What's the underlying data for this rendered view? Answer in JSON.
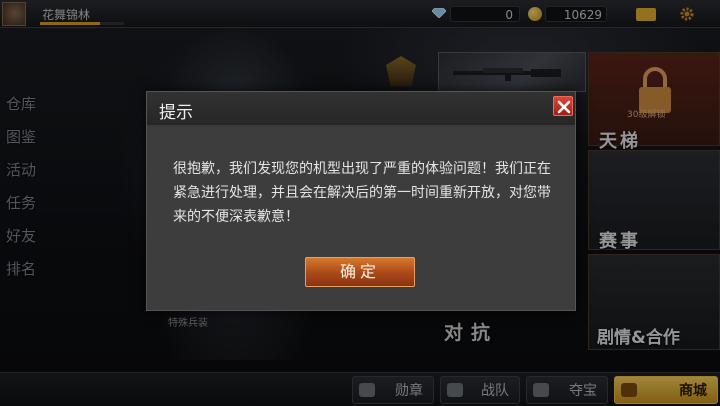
{
  "player": {
    "name": "花舞锦林",
    "xp_progress": 0.72
  },
  "currency": {
    "diamonds": "0",
    "gold": "10629",
    "diamond_icon": "diamond-icon",
    "gold_icon": "gold-coin-icon"
  },
  "left_menu": {
    "items": [
      {
        "label": "仓库"
      },
      {
        "label": "图鉴"
      },
      {
        "label": "活动"
      },
      {
        "label": "任务"
      },
      {
        "label": "好友"
      },
      {
        "label": "排名"
      }
    ]
  },
  "tiles": {
    "ladder_label": "天梯",
    "ladder_caption": "30级解锁",
    "match_label": "赛事",
    "story_label": "剧情&合作",
    "versus_label": "对抗"
  },
  "soldier_caption": "特殊兵装",
  "bottom": {
    "medal": "勋章",
    "team": "战队",
    "treasure": "夺宝",
    "shop": "商城"
  },
  "dialog": {
    "title": "提示",
    "message": "很抱歉，我们发现您的机型出现了严重的体验问题！我们正在紧急进行处理，并且会在解决后的第一时间重新开放，对您带来的不便深表歉意！",
    "confirm_label": "确定"
  },
  "colors": {
    "accent_gold": "#e0b030",
    "confirm_orange": "#c8601e",
    "close_red": "#c42a20"
  }
}
